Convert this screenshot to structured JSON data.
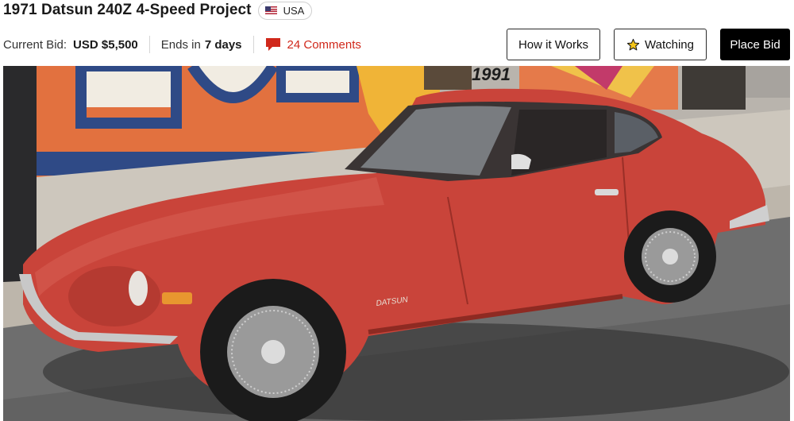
{
  "listing": {
    "title": "1971 Datsun 240Z 4-Speed Project",
    "country": "USA"
  },
  "bid": {
    "label": "Current Bid:",
    "value": "USD $5,500"
  },
  "ends": {
    "label": "Ends in",
    "value": "7 days"
  },
  "comments": {
    "label": "24 Comments"
  },
  "buttons": {
    "how_it_works": "How it Works",
    "watching": "Watching",
    "place_bid": "Place Bid"
  },
  "photo": {
    "mural_text": "1991",
    "badge_text": "DATSUN"
  },
  "icons": {
    "flag": "us-flag-icon",
    "comment": "comment-icon",
    "star": "star-icon"
  },
  "colors": {
    "comments_red": "#d0281b",
    "place_bid_bg": "#000000",
    "car_red": "#c9443a"
  }
}
